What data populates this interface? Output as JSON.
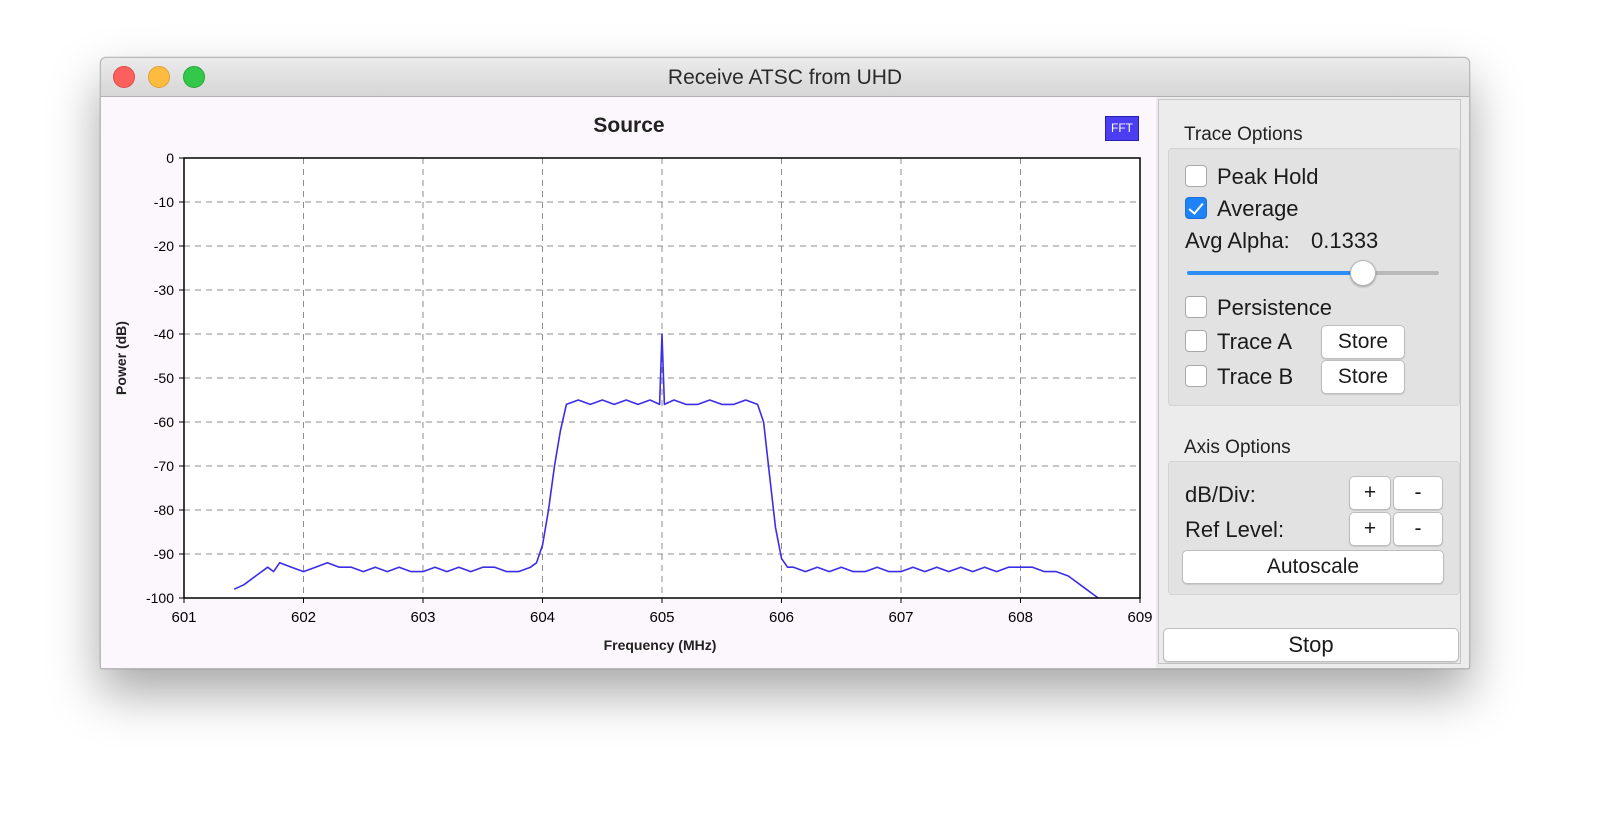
{
  "window": {
    "title": "Receive ATSC from UHD"
  },
  "fft_tag": "FFT",
  "chart_data": {
    "type": "line",
    "title": "Source",
    "xlabel": "Frequency (MHz)",
    "ylabel": "Power (dB)",
    "xlim": [
      601,
      609
    ],
    "ylim": [
      -100,
      0
    ],
    "x_ticks": [
      601,
      602,
      603,
      604,
      605,
      606,
      607,
      608,
      609
    ],
    "y_ticks": [
      0,
      -10,
      -20,
      -30,
      -40,
      -50,
      -60,
      -70,
      -80,
      -90,
      -100
    ],
    "grid": true,
    "series": [
      {
        "color": "#3b2ee8",
        "x": [
          601.42,
          601.5,
          601.6,
          601.7,
          601.75,
          601.8,
          601.9,
          602.0,
          602.1,
          602.2,
          602.3,
          602.4,
          602.5,
          602.6,
          602.7,
          602.8,
          602.9,
          603.0,
          603.1,
          603.2,
          603.3,
          603.4,
          603.5,
          603.6,
          603.7,
          603.8,
          603.9,
          603.95,
          604.0,
          604.05,
          604.1,
          604.15,
          604.2,
          604.3,
          604.4,
          604.5,
          604.6,
          604.7,
          604.8,
          604.9,
          604.98,
          605.0,
          605.02,
          605.1,
          605.2,
          605.3,
          605.4,
          605.5,
          605.6,
          605.7,
          605.8,
          605.85,
          605.9,
          605.95,
          606.0,
          606.05,
          606.1,
          606.2,
          606.3,
          606.4,
          606.5,
          606.6,
          606.7,
          606.8,
          606.9,
          607.0,
          607.1,
          607.2,
          607.3,
          607.4,
          607.5,
          607.6,
          607.7,
          607.8,
          607.9,
          608.0,
          608.1,
          608.2,
          608.3,
          608.4,
          608.45,
          608.5,
          608.55,
          608.6,
          608.65
        ],
        "y": [
          -98,
          -97,
          -95,
          -93,
          -94,
          -92,
          -93,
          -94,
          -93,
          -92,
          -93,
          -93,
          -94,
          -93,
          -94,
          -93,
          -94,
          -94,
          -93,
          -94,
          -93,
          -94,
          -93,
          -93,
          -94,
          -94,
          -93,
          -92,
          -88,
          -80,
          -70,
          -62,
          -56,
          -55,
          -56,
          -55,
          -56,
          -55,
          -56,
          -55,
          -56,
          -40,
          -56,
          -55,
          -56,
          -56,
          -55,
          -56,
          -56,
          -55,
          -56,
          -60,
          -72,
          -84,
          -91,
          -93,
          -93,
          -94,
          -93,
          -94,
          -93,
          -94,
          -94,
          -93,
          -94,
          -94,
          -93,
          -94,
          -93,
          -94,
          -93,
          -94,
          -93,
          -94,
          -93,
          -93,
          -93,
          -94,
          -94,
          -95,
          -96,
          -97,
          -98,
          -99,
          -100
        ]
      }
    ]
  },
  "trace_options": {
    "title": "Trace Options",
    "peak_hold": {
      "label": "Peak Hold",
      "checked": false
    },
    "average": {
      "label": "Average",
      "checked": true
    },
    "avg_alpha": {
      "label": "Avg Alpha:",
      "value": "0.1333",
      "slider_fraction": 0.7
    },
    "persistence": {
      "label": "Persistence",
      "checked": false
    },
    "trace_a": {
      "label": "Trace A",
      "store_label": "Store",
      "checked": false
    },
    "trace_b": {
      "label": "Trace B",
      "store_label": "Store",
      "checked": false
    }
  },
  "axis_options": {
    "title": "Axis Options",
    "db_div": {
      "label": "dB/Div:",
      "plus": "+",
      "minus": "-"
    },
    "ref_level": {
      "label": "Ref Level:",
      "plus": "+",
      "minus": "-"
    },
    "autoscale": "Autoscale"
  },
  "stop_label": "Stop"
}
